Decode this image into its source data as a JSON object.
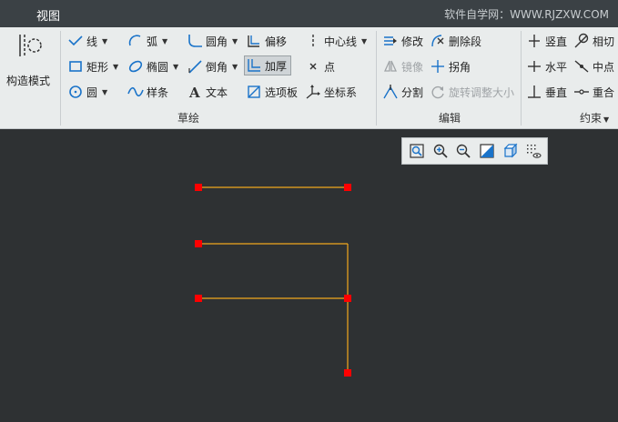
{
  "titlebar": {
    "tab_label": "视图",
    "watermark": "软件自学网：WWW.RJZXW.COM"
  },
  "ribbon": {
    "construct_mode_label": "构造模式",
    "sketch_group": {
      "label": "草绘",
      "line": "线",
      "arc": "弧",
      "fillet": "圆角",
      "offset": "偏移",
      "centerline": "中心线",
      "rectangle": "矩形",
      "ellipse": "椭圆",
      "chamfer": "倒角",
      "thicken": "加厚",
      "point": "点",
      "circle": "圆",
      "spline": "样条",
      "text": "文本",
      "palette": "选项板",
      "coord_system": "坐标系"
    },
    "edit_group": {
      "label": "编辑",
      "modify": "修改",
      "delete_segment": "删除段",
      "mirror": "镜像",
      "corner": "拐角",
      "divide": "分割",
      "rotate_resize": "旋转调整大小"
    },
    "constrain_group": {
      "label": "约束",
      "vertical": "竖直",
      "tangent": "相切",
      "horizontal": "水平",
      "midpoint": "中点",
      "perpendicular": "垂直",
      "coincident": "重合"
    }
  },
  "colors": {
    "canvas_bg": "#2e3133",
    "sketch_line": "#f2a81d",
    "endpoint": "#ff0000"
  }
}
